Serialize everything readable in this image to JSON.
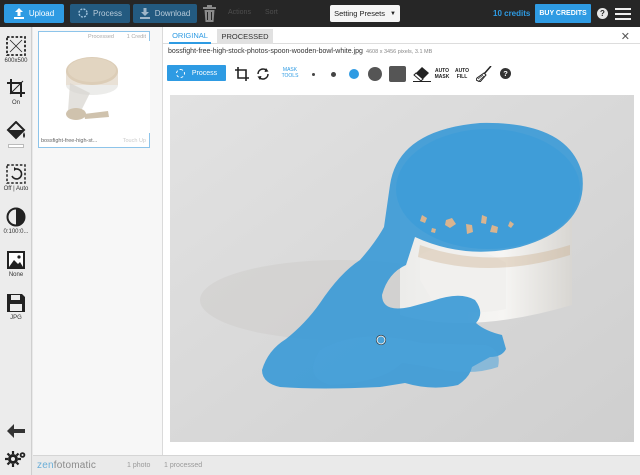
{
  "topbar": {
    "upload_label": "Upload",
    "process_label": "Process",
    "download_label": "Download",
    "dim1": "Actions",
    "dim2": "Sort",
    "preset_label": "Setting Presets",
    "credits_label": "10 credits",
    "buy_label": "BUY CREDITS",
    "help_label": "?"
  },
  "sidebar": {
    "crop_size_label": "600x500",
    "crop_label": "On",
    "autofix_label": "Off | Auto",
    "contrast_label": "0:100:0...",
    "effect_label": "None",
    "format_label": "JPG"
  },
  "thumbnail": {
    "status": "Processed",
    "cost": "1 Credit",
    "name": "bossfight-free-high-st...",
    "touchup": "Touch Up"
  },
  "main": {
    "tab_original": "ORIGINAL",
    "tab_processed": "PROCESSED",
    "close": "✕",
    "filename": "bossfight-free-high-stock-photos-spoon-wooden-bowl-white.jpg",
    "fileinfo": "4608 x 3456 pixels, 3.1 MB",
    "process_label": "Process",
    "mask_tools_line1": "MASK",
    "mask_tools_line2": "TOOLS",
    "auto_mask_line1": "AUTO",
    "auto_mask_line2": "MASK",
    "auto_fill_line1": "AUTO",
    "auto_fill_line2": "FILL",
    "help_label": "?"
  },
  "status": {
    "logo_prefix": "zen",
    "logo_suffix": "fotomatic",
    "photos": "1 photo",
    "processed": "1 processed"
  },
  "colors": {
    "accent": "#2e9be3",
    "mask": "#3d9bd6"
  }
}
